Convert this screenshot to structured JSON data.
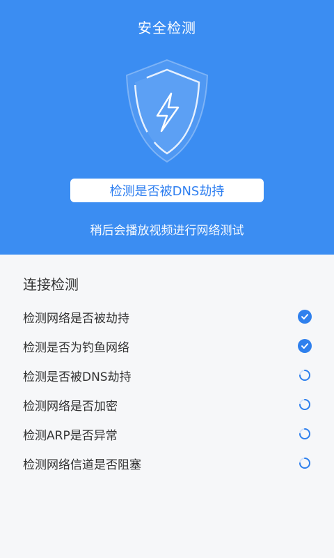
{
  "header": {
    "title": "安全检测"
  },
  "hero": {
    "status_text": "检测是否被DNS劫持",
    "subtext": "稍后会播放视频进行网络测试",
    "shield_icon": "shield-lightning-icon"
  },
  "section": {
    "title": "连接检测"
  },
  "checks": [
    {
      "label": "检测网络是否被劫持",
      "state": "done"
    },
    {
      "label": "检测是否为钓鱼网络",
      "state": "done"
    },
    {
      "label": "检测是否被DNS劫持",
      "state": "loading"
    },
    {
      "label": "检测网络是否加密",
      "state": "loading"
    },
    {
      "label": "检测ARP是否异常",
      "state": "loading"
    },
    {
      "label": "检测网络信道是否阻塞",
      "state": "loading"
    }
  ],
  "colors": {
    "primary": "#3b8df2",
    "accent": "#2f80ed",
    "background": "#f6f7f9",
    "text": "#333333"
  }
}
